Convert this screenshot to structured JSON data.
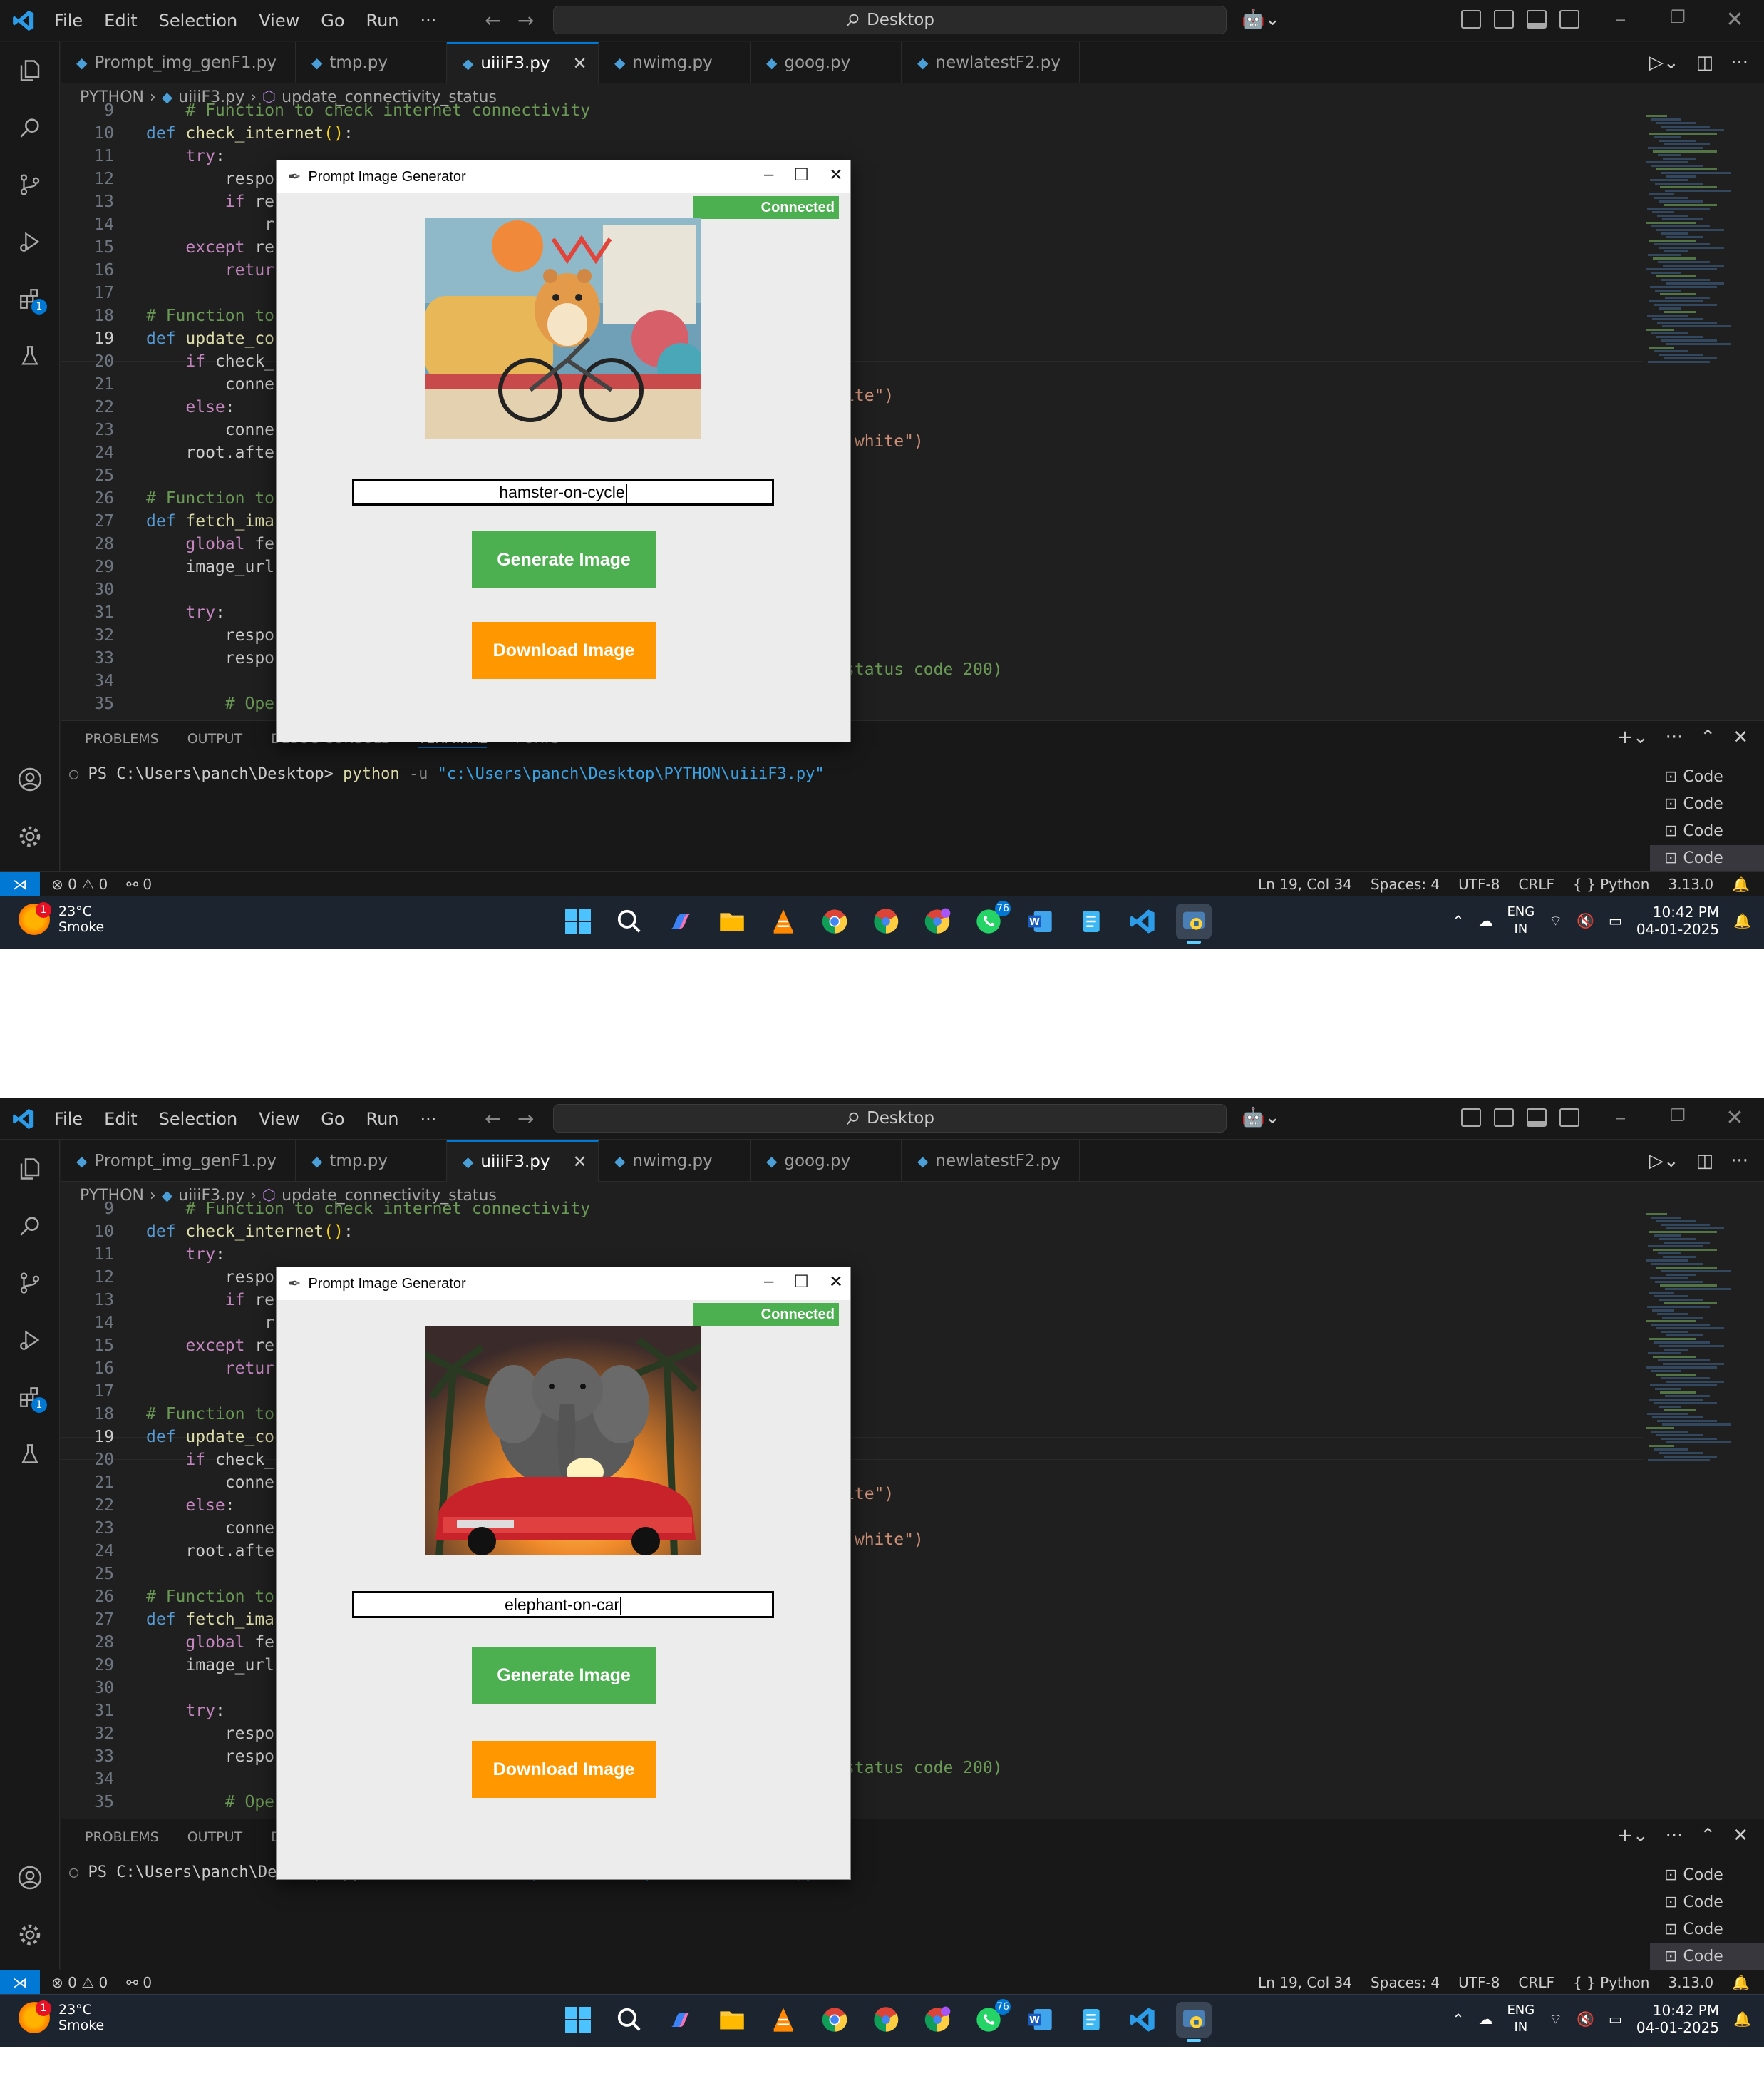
{
  "menu": [
    "File",
    "Edit",
    "Selection",
    "View",
    "Go",
    "Run",
    "···"
  ],
  "search": {
    "label": "Desktop"
  },
  "tabs": [
    "Prompt_img_genF1.py",
    "tmp.py",
    "uiiiF3.py",
    "nwimg.py",
    "goog.py",
    "newlatestF2.py"
  ],
  "breadcrumb": {
    "folder": "PYTHON",
    "file": "uiiiF3.py",
    "symbol": "update_connectivity_status"
  },
  "code": [
    {
      "n": "9",
      "t": "    # Function to check internet connectivity"
    },
    {
      "n": "10",
      "t": "def check_internet():"
    },
    {
      "n": "11",
      "t": "    try:"
    },
    {
      "n": "12",
      "t": "        respo"
    },
    {
      "n": "13",
      "t": "        if res"
    },
    {
      "n": "14",
      "t": "            r"
    },
    {
      "n": "15",
      "t": "    except re"
    },
    {
      "n": "16",
      "t": "        retur"
    },
    {
      "n": "17",
      "t": ""
    },
    {
      "n": "18",
      "t": "# Function to"
    },
    {
      "n": "19",
      "t": "def update_co"
    },
    {
      "n": "20",
      "t": "    if check_"
    },
    {
      "n": "21",
      "t": "        conne"
    },
    {
      "n": "22",
      "t": "    else:"
    },
    {
      "n": "23",
      "t": "        conne"
    },
    {
      "n": "24",
      "t": "    root.afte"
    },
    {
      "n": "25",
      "t": ""
    },
    {
      "n": "26",
      "t": "# Function to"
    },
    {
      "n": "27",
      "t": "def fetch_ima"
    },
    {
      "n": "28",
      "t": "    global fe"
    },
    {
      "n": "29",
      "t": "    image_url"
    },
    {
      "n": "30",
      "t": ""
    },
    {
      "n": "31",
      "t": "    try:"
    },
    {
      "n": "32",
      "t": "        respo"
    },
    {
      "n": "33",
      "t": "        respo"
    },
    {
      "n": "34",
      "t": ""
    },
    {
      "n": "35",
      "t": "        # Ope"
    }
  ],
  "code_right": {
    "r21": "ite\")",
    "r23": "'white\")",
    "r33": "status code 200)"
  },
  "panel": {
    "tabs": [
      "PROBLEMS",
      "OUTPUT",
      "DEBUG CONSOLE",
      "TERMINAL",
      "PORTS"
    ]
  },
  "terminal": {
    "prompt": "PS C:\\Users\\panch\\Desktop>",
    "cmd": "python",
    "flag": "-u",
    "path": "\"c:\\Users\\panch\\Desktop\\PYTHON\\uiiiF3.py\""
  },
  "terminal_list": [
    "Code",
    "Code",
    "Code",
    "Code"
  ],
  "status": {
    "errors": "0",
    "warnings": "0",
    "ports": "0",
    "position": "Ln 19, Col 34",
    "spaces": "Spaces: 4",
    "encoding": "UTF-8",
    "eol": "CRLF",
    "language": "Python",
    "version": "3.13.0"
  },
  "taskbar": {
    "temp": "23°C",
    "weather": "Smoke",
    "weather_badge": "1",
    "lang1": "ENG",
    "lang2": "IN",
    "time": "10:42 PM",
    "date": "04-01-2025",
    "whatsapp_badge": "76"
  },
  "app": {
    "title": "Prompt Image Generator",
    "status": "Connected",
    "generate_label": "Generate Image",
    "download_label": "Download Image",
    "status_color": "#4caf50",
    "download_color": "#ff9800"
  },
  "screens": [
    {
      "prompt_value": "hamster-on-cycle",
      "image_subject": "hamster riding a bicycle"
    },
    {
      "prompt_value": "elephant-on-car",
      "image_subject": "elephant on a red convertible car"
    }
  ]
}
